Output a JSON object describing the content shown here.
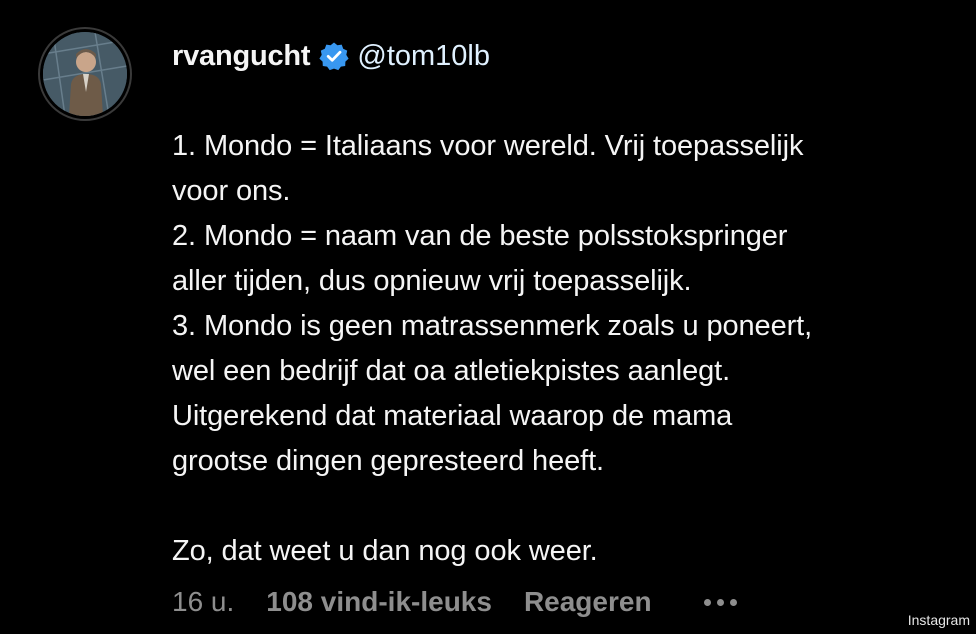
{
  "post": {
    "username": "rvangucht",
    "mention": "@tom10lb",
    "caption_lines": [
      "1. Mondo = Italiaans voor wereld. Vrij toepasselijk",
      "voor ons.",
      "2. Mondo = naam van de beste polsstokspringer",
      "aller tijden, dus opnieuw vrij toepasselijk.",
      "3. Mondo is geen matrassenmerk zoals u poneert,",
      "wel een bedrijf dat oa atletiekpistes aanlegt.",
      "Uitgerekend dat materiaal waarop de mama",
      "grootse dingen gepresteerd heeft.",
      "Zo, dat weet u dan nog ook weer."
    ]
  },
  "footer": {
    "time": "16 u.",
    "likes": "108 vind-ik-leuks",
    "reply": "Reageren"
  },
  "watermark": "Instagram",
  "colors": {
    "background": "#000000",
    "text": "#f5f5f5",
    "muted": "#8e8e8e",
    "verified": "#3897f0"
  },
  "icons": {
    "verified": "verified-badge-icon",
    "more": "more-options-icon"
  }
}
